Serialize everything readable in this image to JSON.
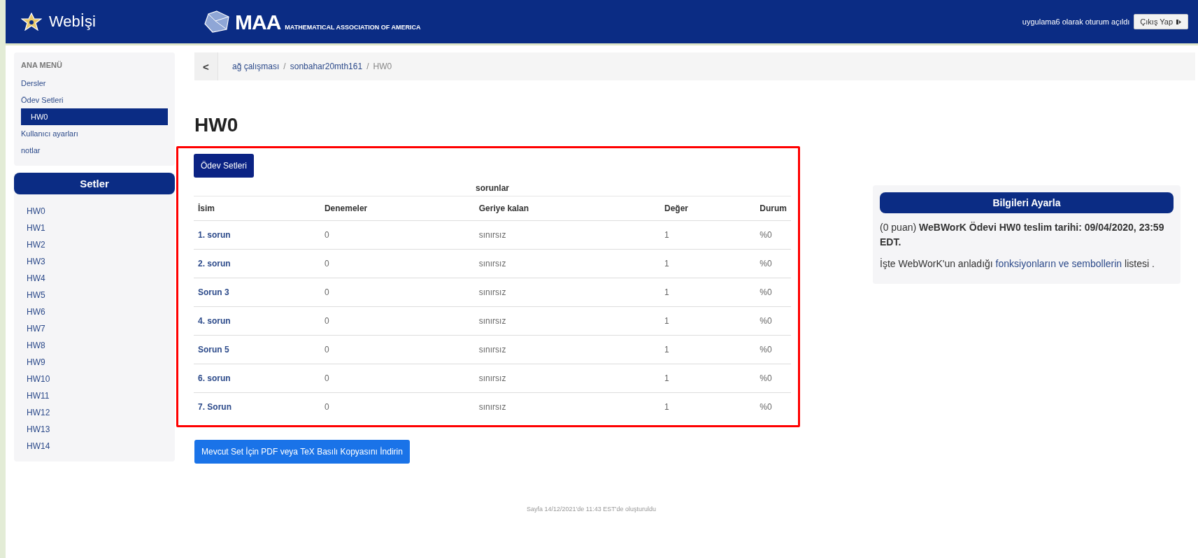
{
  "header": {
    "brand": "Webİşi",
    "logo_text": "MAA",
    "logo_subtitle": "MATHEMATICAL ASSOCIATION OF AMERICA",
    "login_status": "uygulama6 olarak oturum açıldı",
    "logout_button": "Çıkış Yap"
  },
  "sidebar": {
    "main_menu": {
      "title": "ANA MENÜ",
      "items": [
        {
          "label": "Dersler",
          "selected": false
        },
        {
          "label": "Ödev Setleri",
          "selected": false,
          "children": [
            {
              "label": "HW0",
              "selected": true
            }
          ]
        },
        {
          "label": "Kullanıcı ayarları",
          "selected": false
        },
        {
          "label": "notlar",
          "selected": false
        }
      ]
    },
    "sets": {
      "title": "Setler",
      "items": [
        "HW0",
        "HW1",
        "HW2",
        "HW3",
        "HW4",
        "HW5",
        "HW6",
        "HW7",
        "HW8",
        "HW9",
        "HW10",
        "HW11",
        "HW12",
        "HW13",
        "HW14"
      ]
    }
  },
  "breadcrumb": {
    "back": "<",
    "separator": "/",
    "items": [
      {
        "label": "ağ çalışması",
        "link": true
      },
      {
        "label": "sonbahar20mth161",
        "link": true
      },
      {
        "label": "HW0",
        "link": false
      }
    ]
  },
  "page_title": "HW0",
  "sets_button": "Ödev Setleri",
  "table": {
    "caption": "sorunlar",
    "columns": [
      "İsim",
      "Denemeler",
      "Geriye kalan",
      "Değer",
      "Durum"
    ],
    "rows": [
      [
        "1. sorun",
        "0",
        "sınırsız",
        "1",
        "%0"
      ],
      [
        "2. sorun",
        "0",
        "sınırsız",
        "1",
        "%0"
      ],
      [
        "Sorun 3",
        "0",
        "sınırsız",
        "1",
        "%0"
      ],
      [
        "4. sorun",
        "0",
        "sınırsız",
        "1",
        "%0"
      ],
      [
        "Sorun 5",
        "0",
        "sınırsız",
        "1",
        "%0"
      ],
      [
        "6. sorun",
        "0",
        "sınırsız",
        "1",
        "%0"
      ],
      [
        "7. Sorun",
        "0",
        "sınırsız",
        "1",
        "%0"
      ]
    ]
  },
  "download_button": "Mevcut Set İçin PDF veya TeX Basılı Kopyasını İndirin",
  "info_panel": {
    "title": "Bilgileri Ayarla",
    "due_text": "(0 puan) **WeBWorK Ödevi HW0 teslim tarihi: 09/04/2020, 23:59 EDT.**",
    "help_before": "İşte WebWorK'un anladığı ",
    "help_link": "fonksiyonların ve sembollerin",
    "help_after": " listesi ."
  },
  "footer": "Sayfa 14/12/2021'de 11:43 EST'de oluşturuldu"
}
